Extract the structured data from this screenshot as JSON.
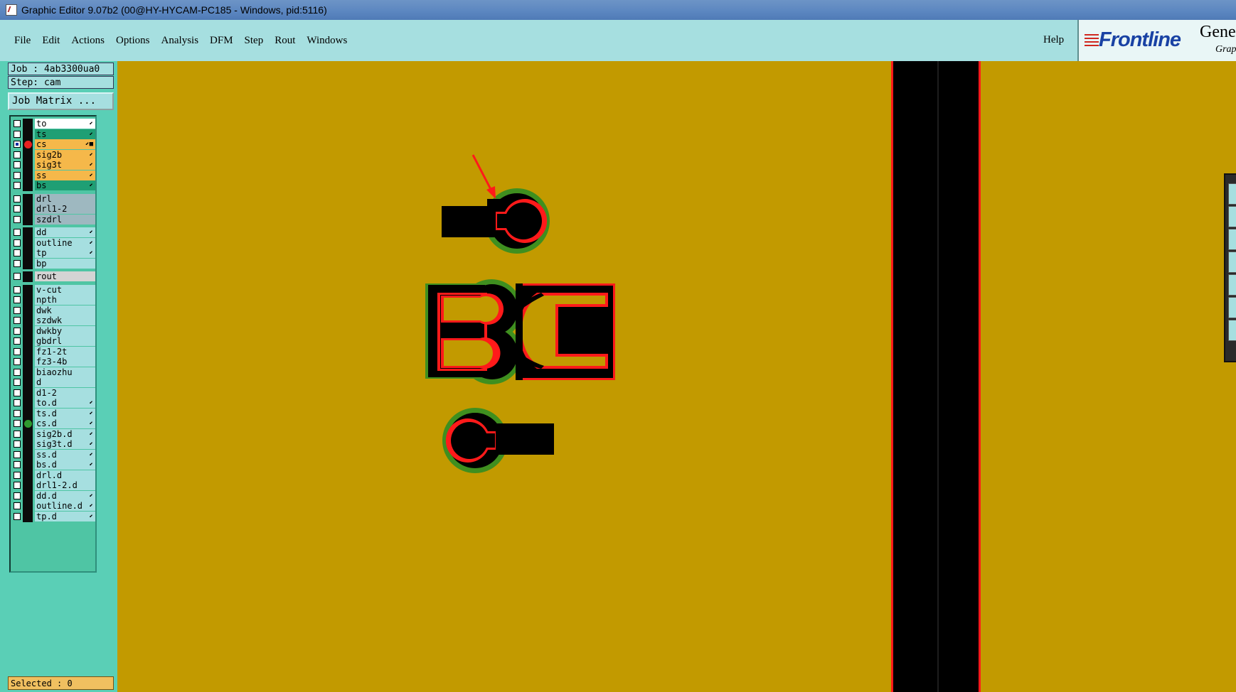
{
  "window": {
    "title": "Graphic Editor 9.07b2 (00@HY-HYCAM-PC185 - Windows, pid:5116)"
  },
  "menu": {
    "items": [
      "File",
      "Edit",
      "Actions",
      "Options",
      "Analysis",
      "DFM",
      "Step",
      "Rout",
      "Windows"
    ],
    "help": "Help"
  },
  "logo": {
    "brand": "Frontline",
    "product_partial": "Gene",
    "subtitle_partial": "Grap"
  },
  "panel": {
    "job": "Job : 4ab3300ua0",
    "step": "Step: cam",
    "job_matrix": "Job Matrix ...",
    "selected": "Selected : 0"
  },
  "layers": [
    {
      "name": "to",
      "bg": "#ffffff",
      "mark": "⬋",
      "group": 0,
      "dot": "",
      "checked": false
    },
    {
      "name": "ts",
      "bg": "#1f9f74",
      "mark": "⬋",
      "group": 0,
      "dot": "",
      "checked": false
    },
    {
      "name": "cs",
      "bg": "#f5b84a",
      "mark": "⬋■",
      "group": 0,
      "dot": "#e82020",
      "checked": true
    },
    {
      "name": "sig2b",
      "bg": "#f5b84a",
      "mark": "⬋",
      "group": 0,
      "dot": "",
      "checked": false
    },
    {
      "name": "sig3t",
      "bg": "#f5b84a",
      "mark": "⬋",
      "group": 0,
      "dot": "",
      "checked": false
    },
    {
      "name": "ss",
      "bg": "#f5b84a",
      "mark": "⬋",
      "group": 0,
      "dot": "",
      "checked": false
    },
    {
      "name": "bs",
      "bg": "#1f9f74",
      "mark": "⬋",
      "group": 0,
      "dot": "",
      "checked": false
    },
    {
      "name": "drl",
      "bg": "#9eb8c0",
      "mark": "",
      "group": 1,
      "dot": "",
      "checked": false
    },
    {
      "name": "drl1-2",
      "bg": "#9eb8c0",
      "mark": "",
      "group": 1,
      "dot": "",
      "checked": false
    },
    {
      "name": "szdrl",
      "bg": "#9eb8c0",
      "mark": "",
      "group": 1,
      "dot": "",
      "checked": false
    },
    {
      "name": "dd",
      "bg": "#a6dfe0",
      "mark": "⬋",
      "group": 2,
      "dot": "",
      "checked": false
    },
    {
      "name": "outline",
      "bg": "#a6dfe0",
      "mark": "⬋",
      "group": 2,
      "dot": "",
      "checked": false
    },
    {
      "name": "tp",
      "bg": "#a6dfe0",
      "mark": "⬋",
      "group": 2,
      "dot": "",
      "checked": false
    },
    {
      "name": "bp",
      "bg": "#a6dfe0",
      "mark": "",
      "group": 2,
      "dot": "",
      "checked": false
    },
    {
      "name": "rout",
      "bg": "#d4d4d4",
      "mark": "",
      "group": 3,
      "dot": "",
      "checked": false
    },
    {
      "name": "v-cut",
      "bg": "#a6dfe0",
      "mark": "",
      "group": 4,
      "dot": "",
      "checked": false
    },
    {
      "name": "npth",
      "bg": "#a6dfe0",
      "mark": "",
      "group": 4,
      "dot": "",
      "checked": false
    },
    {
      "name": "dwk",
      "bg": "#a6dfe0",
      "mark": "",
      "group": 4,
      "dot": "",
      "checked": false
    },
    {
      "name": "szdwk",
      "bg": "#a6dfe0",
      "mark": "",
      "group": 4,
      "dot": "",
      "checked": false
    },
    {
      "name": "dwkby",
      "bg": "#a6dfe0",
      "mark": "",
      "group": 4,
      "dot": "",
      "checked": false
    },
    {
      "name": "gbdrl",
      "bg": "#a6dfe0",
      "mark": "",
      "group": 4,
      "dot": "",
      "checked": false
    },
    {
      "name": "fz1-2t",
      "bg": "#a6dfe0",
      "mark": "",
      "group": 4,
      "dot": "",
      "checked": false
    },
    {
      "name": "fz3-4b",
      "bg": "#a6dfe0",
      "mark": "",
      "group": 4,
      "dot": "",
      "checked": false
    },
    {
      "name": "biaozhu",
      "bg": "#a6dfe0",
      "mark": "",
      "group": 4,
      "dot": "",
      "checked": false
    },
    {
      "name": "d",
      "bg": "#a6dfe0",
      "mark": "",
      "group": 4,
      "dot": "",
      "checked": false
    },
    {
      "name": "d1-2",
      "bg": "#a6dfe0",
      "mark": "",
      "group": 4,
      "dot": "",
      "checked": false
    },
    {
      "name": "to.d",
      "bg": "#a6dfe0",
      "mark": "⬋",
      "group": 4,
      "dot": "",
      "checked": false
    },
    {
      "name": "ts.d",
      "bg": "#a6dfe0",
      "mark": "⬋",
      "group": 4,
      "dot": "",
      "checked": false
    },
    {
      "name": "cs.d",
      "bg": "#a6dfe0",
      "mark": "⬋",
      "group": 4,
      "dot": "#2f9a2f",
      "checked": false
    },
    {
      "name": "sig2b.d",
      "bg": "#a6dfe0",
      "mark": "⬋",
      "group": 4,
      "dot": "",
      "checked": false
    },
    {
      "name": "sig3t.d",
      "bg": "#a6dfe0",
      "mark": "⬋",
      "group": 4,
      "dot": "",
      "checked": false
    },
    {
      "name": "ss.d",
      "bg": "#a6dfe0",
      "mark": "⬋",
      "group": 4,
      "dot": "",
      "checked": false
    },
    {
      "name": "bs.d",
      "bg": "#a6dfe0",
      "mark": "⬋",
      "group": 4,
      "dot": "",
      "checked": false
    },
    {
      "name": "drl.d",
      "bg": "#a6dfe0",
      "mark": "",
      "group": 4,
      "dot": "",
      "checked": false
    },
    {
      "name": "drl1-2.d",
      "bg": "#a6dfe0",
      "mark": "",
      "group": 4,
      "dot": "",
      "checked": false
    },
    {
      "name": "dd.d",
      "bg": "#a6dfe0",
      "mark": "⬋",
      "group": 4,
      "dot": "",
      "checked": false
    },
    {
      "name": "outline.d",
      "bg": "#a6dfe0",
      "mark": "⬋",
      "group": 4,
      "dot": "",
      "checked": false
    },
    {
      "name": "tp.d",
      "bg": "#a6dfe0",
      "mark": "⬋",
      "group": 4,
      "dot": "",
      "checked": false
    }
  ],
  "colors": {
    "canvas_bg": "#c29a00",
    "copper": "#000000",
    "outline_red": "#ff1a1a",
    "highlight_green": "#3f8f1f",
    "panel_bg": "#5acfb6",
    "menubar_bg": "#a6dfe0"
  }
}
